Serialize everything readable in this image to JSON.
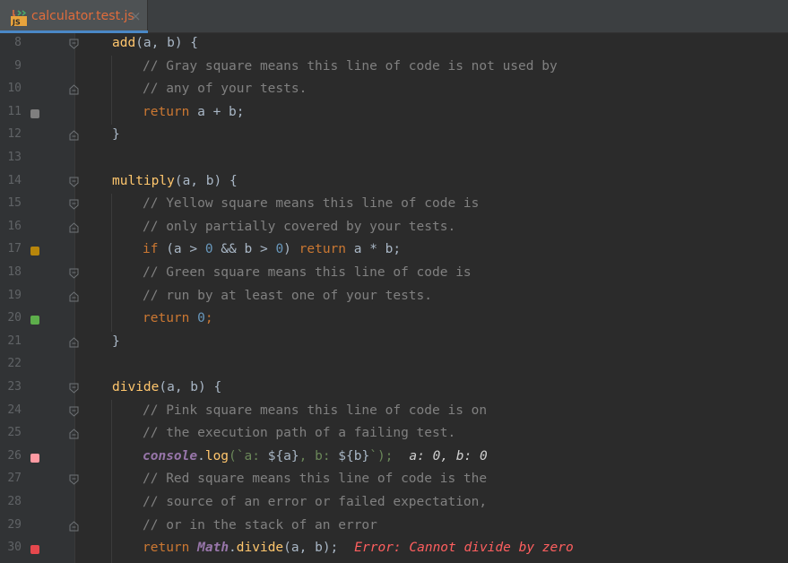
{
  "tab": {
    "title": "calculator.test.js",
    "icon": "js-file-icon",
    "close": "×"
  },
  "colors": {
    "gray": "#7f7f7f",
    "yellow": "#b8860b",
    "green": "#5dae4b",
    "pink": "#ff9aa2",
    "red": "#e5484d"
  },
  "lines": [
    {
      "n": "8",
      "fold": "start"
    },
    {
      "n": "9",
      "fold": "none"
    },
    {
      "n": "10",
      "fold": "end"
    },
    {
      "n": "11",
      "fold": "none",
      "cov": "gray"
    },
    {
      "n": "12",
      "fold": "end"
    },
    {
      "n": "13",
      "fold": "none"
    },
    {
      "n": "14",
      "fold": "start"
    },
    {
      "n": "15",
      "fold": "start"
    },
    {
      "n": "16",
      "fold": "end"
    },
    {
      "n": "17",
      "fold": "none",
      "cov": "yellow"
    },
    {
      "n": "18",
      "fold": "start"
    },
    {
      "n": "19",
      "fold": "end"
    },
    {
      "n": "20",
      "fold": "none",
      "cov": "green"
    },
    {
      "n": "21",
      "fold": "end"
    },
    {
      "n": "22",
      "fold": "none"
    },
    {
      "n": "23",
      "fold": "start"
    },
    {
      "n": "24",
      "fold": "start"
    },
    {
      "n": "25",
      "fold": "end"
    },
    {
      "n": "26",
      "fold": "none",
      "cov": "pink"
    },
    {
      "n": "27",
      "fold": "start"
    },
    {
      "n": "28",
      "fold": "none"
    },
    {
      "n": "29",
      "fold": "end"
    },
    {
      "n": "30",
      "fold": "none",
      "cov": "red"
    }
  ],
  "code": {
    "l8": {
      "name": "add",
      "rest": "(a, b) {"
    },
    "l9": "// Gray square means this line of code is not used by",
    "l10": "// any of your tests.",
    "l11": {
      "kw": "return",
      "rest": " a + b;"
    },
    "l12": "}",
    "l14": {
      "name": "multiply",
      "rest": "(a, b) {"
    },
    "l15": "// Yellow square means this line of code is",
    "l16": "// only partially covered by your tests.",
    "l17": {
      "kw": "if",
      "p1": " (a > ",
      "n1": "0",
      "p2": " && b > ",
      "n2": "0",
      "p3": ") ",
      "kw2": "return",
      "p4": " a * b;"
    },
    "l18": "// Green square means this line of code is",
    "l19": "// run by at least one of your tests.",
    "l20": {
      "kw": "return",
      "sp": " ",
      "num": "0",
      "end": ";"
    },
    "l21": "}",
    "l23": {
      "name": "divide",
      "rest": "(a, b) {"
    },
    "l24": "// Pink square means this line of code is on",
    "l25": "// the execution path of a failing test.",
    "l26": {
      "glob": "console",
      "dot": ".",
      "fn": "log",
      "open": "(`",
      "s1": "a: ",
      "t1": "${a}",
      "s2": ", b: ",
      "t2": "${b}",
      "close": "`);",
      "hint": "a: 0, b: 0"
    },
    "l27": "// Red square means this line of code is the",
    "l28": "// source of an error or failed expectation,",
    "l29": "// or in the stack of an error",
    "l30": {
      "kw": "return",
      "sp": " ",
      "glob": "Math",
      "dot": ".",
      "fn": "divide",
      "rest": "(a, b);",
      "err": "Error: Cannot divide by zero"
    }
  }
}
